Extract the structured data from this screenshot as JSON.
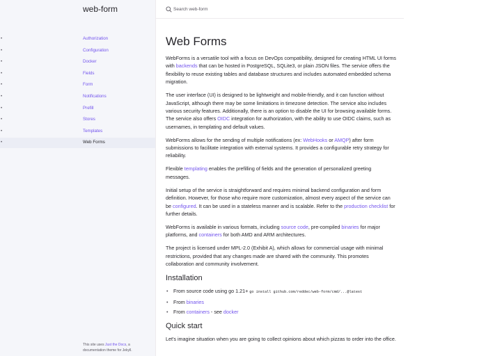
{
  "site": {
    "title": "web-form",
    "footer_prefix": "This site uses ",
    "footer_link": "Just the Docs",
    "footer_suffix": ", a documentation theme for Jekyll."
  },
  "search": {
    "placeholder": "Search web-form",
    "icon": "search-icon"
  },
  "nav": {
    "items": [
      {
        "label": "Authorization"
      },
      {
        "label": "Configuration"
      },
      {
        "label": "Docker"
      },
      {
        "label": "Fields"
      },
      {
        "label": "Form"
      },
      {
        "label": "Notifications"
      },
      {
        "label": "Prefill"
      },
      {
        "label": "Stores"
      },
      {
        "label": "Templates"
      },
      {
        "label": "Web Forms"
      }
    ],
    "active": "Web Forms"
  },
  "page": {
    "title": "Web Forms",
    "p1": {
      "a": "WebForms is a versatile tool with a focus on DevOps compatibility, designed for creating HTML UI forms with ",
      "link1": "backends",
      "b": " that can be hosted in PostgreSQL, SQLite3, or plain JSON files. The service offers the flexibility to reuse existing tables and database structures and includes automated embedded schema migration."
    },
    "p2": {
      "a": "The user interface (UI) is designed to be lightweight and mobile-friendly, and it can function without JavaScript, although there may be some limitations in timezone detection. The service also includes various security features. Additionally, there is an option to disable the UI for browsing available forms. The service also offers ",
      "link1": "OIDC",
      "b": " integration for authorization, with the ability to use OIDC claims, such as usernames, in templating and default values."
    },
    "p3": {
      "a": "WebForms allows for the sending of multiple notifications (ex: ",
      "link1": "WebHooks",
      "b": " or ",
      "link2": "AMQP",
      "c": ") after form submissions to facilitate integration with external systems. It provides a configurable retry strategy for reliability."
    },
    "p4": {
      "a": "Flexible ",
      "link1": "templating",
      "b": " enables the prefilling of fields and the generation of personalized greeting messages."
    },
    "p5": {
      "a": "Initial setup of the service is straightforward and requires minimal backend configuration and form definition. However, for those who require more customization, almost every aspect of the service can be ",
      "link1": "configured",
      "b": ". It can be used in a stateless manner and is scalable. Refer to the ",
      "link2": "production checklist",
      "c": " for further details."
    },
    "p6": {
      "a": "WebForms is available in various formats, including ",
      "link1": "source code",
      "b": ", pre-compiled ",
      "link2": "binaries",
      "c": " for major platforms, and ",
      "link3": "containers",
      "d": " for both AMD and ARM architectures."
    },
    "p7": "The project is licensed under MPL-2.0 (Exhibit A), which allows for commercial usage with minimal restrictions, provided that any changes made are shared with the community. This promotes collaboration and community involvement.",
    "installation": {
      "heading": "Installation",
      "items": [
        {
          "prefix": "From source code using go 1.21+ ",
          "code": "go install github.com/reddec/web-form/cmd/...@latest"
        },
        {
          "prefix": "From ",
          "link": "binaries"
        },
        {
          "prefix": "From ",
          "link": "containers",
          "suffix": " - see ",
          "link2": "docker"
        }
      ]
    },
    "quickstart": {
      "heading": "Quick start",
      "p": "Let's imagine situation when you are going to collect opinions about which pizzas to order into the office."
    }
  }
}
